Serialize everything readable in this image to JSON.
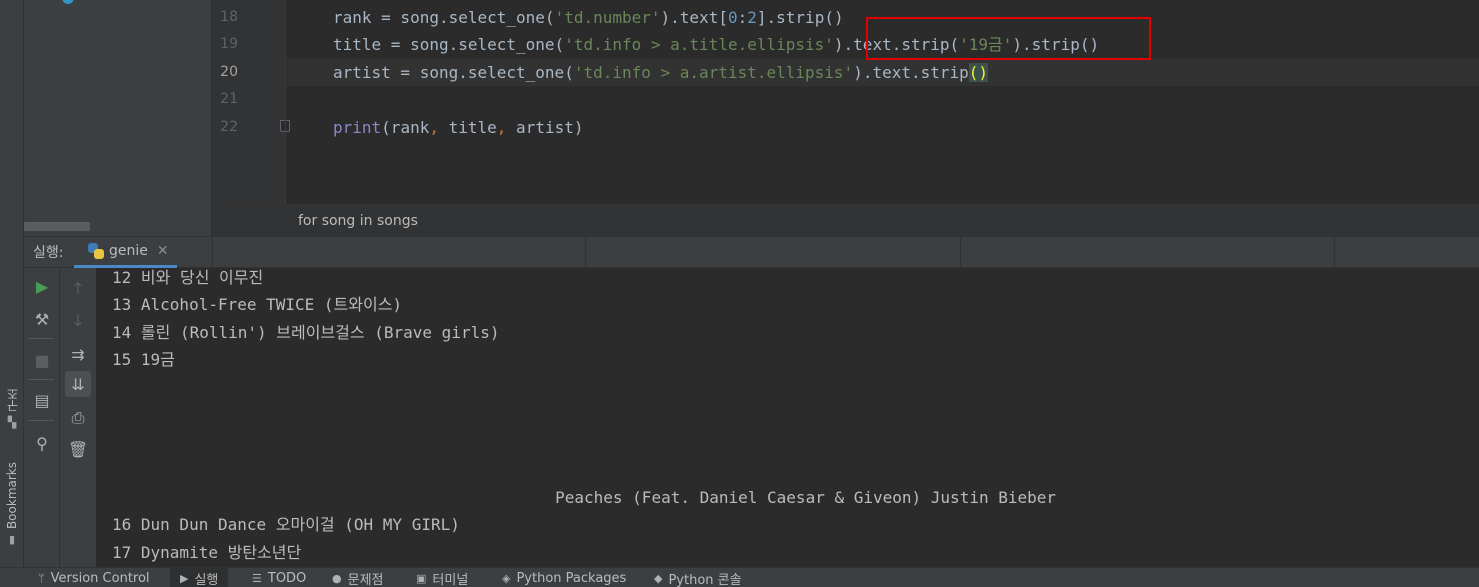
{
  "left_strip": {
    "structure_label": "구조",
    "bookmarks_label": "Bookmarks"
  },
  "editor": {
    "lines": [
      {
        "number": "18",
        "code": "rank = song.select_one('td.number').text[0:2].strip()"
      },
      {
        "number": "19",
        "code": "title = song.select_one('td.info > a.title.ellipsis').text.strip('19금').strip()"
      },
      {
        "number": "20",
        "code": "artist = song.select_one('td.info > a.artist.ellipsis').text.strip()"
      },
      {
        "number": "21",
        "code": ""
      },
      {
        "number": "22",
        "code": "print(rank, title, artist)"
      }
    ],
    "highlighted_fragment": ".text.strip('19금').strip()",
    "breadcrumb": "for song in songs"
  },
  "run_panel": {
    "label": "실행:",
    "tab_name": "genie",
    "toolbar_icons": [
      "run-icon",
      "up-arrow-icon",
      "wrench-icon",
      "down-arrow-icon",
      "stop-icon",
      "soft-wrap-icon",
      "layout-icon",
      "scroll-to-end-icon",
      "print-icon",
      "pin-icon",
      "trash-icon"
    ],
    "console_lines": [
      "12 비와 당신 이무진",
      "13 Alcohol-Free TWICE (트와이스)",
      "14 롤린 (Rollin') 브레이브걸스 (Brave girls)",
      "15 19금",
      "",
      "",
      "",
      "",
      "                                              Peaches (Feat. Daniel Caesar & Giveon) Justin Bieber",
      "16 Dun Dun Dance 오마이걸 (OH MY GIRL)",
      "17 Dynamite 방탄소년단"
    ]
  },
  "bottom_tabs": [
    {
      "label": "Version Control",
      "icon": "branch-icon"
    },
    {
      "label": "실행",
      "icon": "run-icon",
      "selected": true
    },
    {
      "label": "TODO",
      "icon": "list-icon"
    },
    {
      "label": "문제점",
      "icon": "warning-icon"
    },
    {
      "label": "터미널",
      "icon": "terminal-icon"
    },
    {
      "label": "Python Packages",
      "icon": "packages-icon"
    },
    {
      "label": "Python 콘솔",
      "icon": "python-icon"
    }
  ],
  "colors": {
    "highlight_box": "#e30000",
    "run_green": "#499c54",
    "tab_underline": "#4a88c7"
  }
}
